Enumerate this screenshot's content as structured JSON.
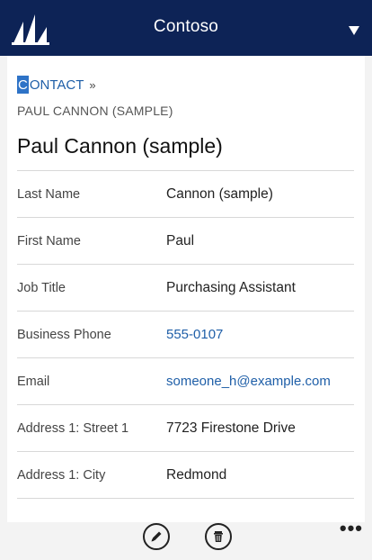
{
  "header": {
    "app_title": "Contoso",
    "logo_icon": "dynamics-sails-logo-icon",
    "menu_icon": "caret-down-icon"
  },
  "breadcrumb": {
    "entity_first": "C",
    "entity_rest": "ONTACT",
    "separator": "»"
  },
  "record": {
    "subtitle": "PAUL CANNON (SAMPLE)",
    "title": "Paul Cannon (sample)"
  },
  "fields": [
    {
      "label": "Last Name",
      "value": "Cannon (sample)"
    },
    {
      "label": "First Name",
      "value": "Paul"
    },
    {
      "label": "Job Title",
      "value": "Purchasing Assistant"
    },
    {
      "label": "Business Phone",
      "value": "555-0107"
    },
    {
      "label": "Email",
      "value": "someone_h@example.com"
    },
    {
      "label": "Address 1: Street 1",
      "value": "7723 Firestone Drive"
    },
    {
      "label": "Address 1: City",
      "value": "Redmond"
    }
  ],
  "commands": {
    "edit_icon": "pencil-icon",
    "delete_icon": "trash-icon",
    "more_label": "•••"
  },
  "colors": {
    "header_bg": "#0d2356",
    "link": "#1f5fa8",
    "breadcrumb_highlight": "#2e73c7"
  }
}
